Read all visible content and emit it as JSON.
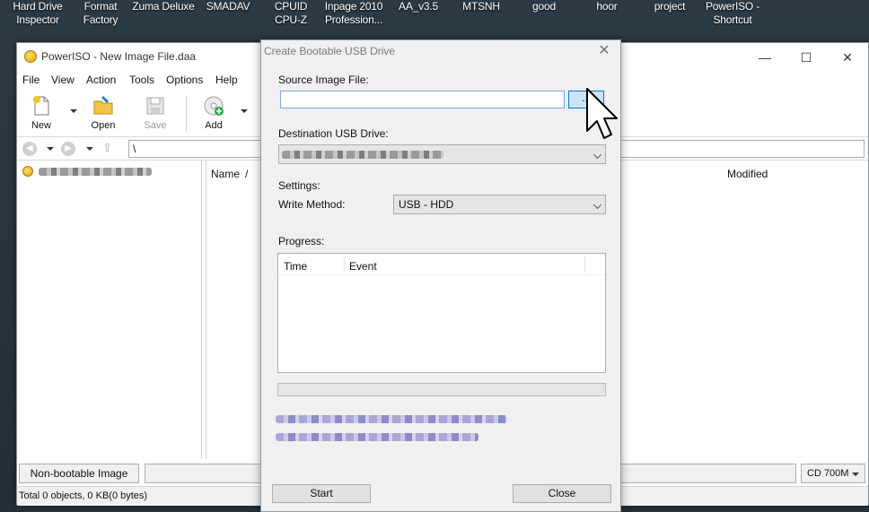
{
  "desktop": {
    "icons": [
      {
        "label_line1": "Hard Drive",
        "label_line2": "Inspector"
      },
      {
        "label_line1": "Format",
        "label_line2": "Factory"
      },
      {
        "label_line1": "Zuma Deluxe",
        "label_line2": ""
      },
      {
        "label_line1": "SMADAV",
        "label_line2": ""
      },
      {
        "label_line1": "CPUID",
        "label_line2": "CPU-Z"
      },
      {
        "label_line1": "Inpage 2010",
        "label_line2": "Profession..."
      },
      {
        "label_line1": "AA_v3.5",
        "label_line2": ""
      },
      {
        "label_line1": "MTSNH",
        "label_line2": ""
      },
      {
        "label_line1": "good",
        "label_line2": ""
      },
      {
        "label_line1": "hoor",
        "label_line2": ""
      },
      {
        "label_line1": "project",
        "label_line2": ""
      },
      {
        "label_line1": "PowerISO -",
        "label_line2": "Shortcut"
      }
    ]
  },
  "main_window": {
    "title": "PowerISO - New Image File.daa",
    "controls": {
      "minimize": "—",
      "maximize": "☐",
      "close": "✕"
    },
    "menu": [
      "File",
      "View",
      "Action",
      "Tools",
      "Options",
      "Help"
    ],
    "toolbar": {
      "new": "New",
      "open": "Open",
      "save": "Save",
      "add": "Add"
    },
    "address": "\\",
    "list_headers": {
      "name": "Name",
      "sort_indicator": "/",
      "modified": "Modified"
    },
    "boot_label": "Non-bootable Image",
    "cd_size": "CD 700M",
    "status": "Total 0 objects, 0 KB(0 bytes)"
  },
  "dialog": {
    "title": "Create Bootable USB Drive",
    "close": "✕",
    "source_label": "Source Image File:",
    "source_value": "",
    "browse_label": "...",
    "dest_label": "Destination USB Drive:",
    "settings_label": "Settings:",
    "write_method_label": "Write Method:",
    "write_method_value": "USB - HDD",
    "progress_label": "Progress:",
    "progress_value": 0,
    "columns": {
      "time": "Time",
      "event": "Event"
    },
    "start_label": "Start",
    "close_label": "Close"
  },
  "colors": {
    "accent": "#0078d7",
    "link_blurred": "#9b9bd6",
    "dialog_bg": "#f0f0f0"
  }
}
